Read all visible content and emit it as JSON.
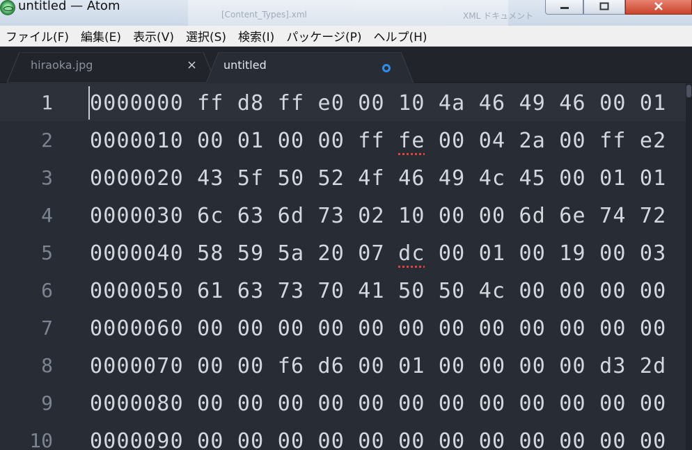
{
  "window": {
    "title": "untitled — Atom",
    "background_ghost": [
      "[Content_Types].xml",
      "XML ドキュメント"
    ]
  },
  "menu": {
    "items": [
      {
        "label": "ファイル(F)"
      },
      {
        "label": "編集(E)"
      },
      {
        "label": "表示(V)"
      },
      {
        "label": "選択(S)"
      },
      {
        "label": "検索(I)"
      },
      {
        "label": "パッケージ(P)"
      },
      {
        "label": "ヘルプ(H)"
      }
    ]
  },
  "tabs": [
    {
      "label": "hiraoka.jpg",
      "active": false,
      "close_glyph": "×"
    },
    {
      "label": "untitled",
      "active": true,
      "modified": true
    }
  ],
  "editor": {
    "current_line": 1,
    "lines": [
      {
        "number": "1",
        "offset": "0000000",
        "bytes": [
          "ff",
          "d8",
          "ff",
          "e0",
          "00",
          "10",
          "4a",
          "46",
          "49",
          "46",
          "00",
          "01"
        ]
      },
      {
        "number": "2",
        "offset": "0000010",
        "bytes": [
          "00",
          "01",
          "00",
          "00",
          "ff",
          "fe",
          "00",
          "04",
          "2a",
          "00",
          "ff",
          "e2"
        ],
        "spell_index": 5
      },
      {
        "number": "3",
        "offset": "0000020",
        "bytes": [
          "43",
          "5f",
          "50",
          "52",
          "4f",
          "46",
          "49",
          "4c",
          "45",
          "00",
          "01",
          "01"
        ]
      },
      {
        "number": "4",
        "offset": "0000030",
        "bytes": [
          "6c",
          "63",
          "6d",
          "73",
          "02",
          "10",
          "00",
          "00",
          "6d",
          "6e",
          "74",
          "72"
        ]
      },
      {
        "number": "5",
        "offset": "0000040",
        "bytes": [
          "58",
          "59",
          "5a",
          "20",
          "07",
          "dc",
          "00",
          "01",
          "00",
          "19",
          "00",
          "03"
        ],
        "spell_index": 5
      },
      {
        "number": "6",
        "offset": "0000050",
        "bytes": [
          "61",
          "63",
          "73",
          "70",
          "41",
          "50",
          "50",
          "4c",
          "00",
          "00",
          "00",
          "00"
        ]
      },
      {
        "number": "7",
        "offset": "0000060",
        "bytes": [
          "00",
          "00",
          "00",
          "00",
          "00",
          "00",
          "00",
          "00",
          "00",
          "00",
          "00",
          "00"
        ]
      },
      {
        "number": "8",
        "offset": "0000070",
        "bytes": [
          "00",
          "00",
          "f6",
          "d6",
          "00",
          "01",
          "00",
          "00",
          "00",
          "00",
          "d3",
          "2d"
        ]
      },
      {
        "number": "9",
        "offset": "0000080",
        "bytes": [
          "00",
          "00",
          "00",
          "00",
          "00",
          "00",
          "00",
          "00",
          "00",
          "00",
          "00",
          "00"
        ]
      },
      {
        "number": "10",
        "offset": "0000090",
        "bytes": [
          "00",
          "00",
          "00",
          "00",
          "00",
          "00",
          "00",
          "00",
          "00",
          "00",
          "00",
          "00"
        ]
      }
    ]
  },
  "colors": {
    "editor_bg": "#282c34",
    "tab_bar_bg": "#21252b",
    "text": "#d3d7de",
    "line_number": "#7c8491",
    "modified_dot": "#2d8ee8",
    "spell_underline": "#e0443d"
  }
}
